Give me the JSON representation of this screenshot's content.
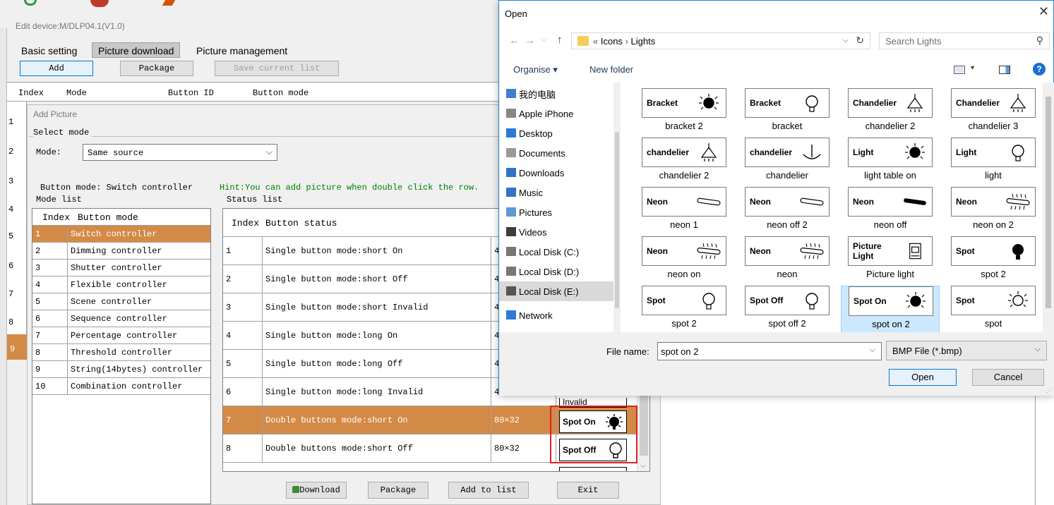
{
  "main": {
    "title": "Edit device:M/DLP04.1(V1.0)",
    "tabs": [
      "Basic setting",
      "Picture download",
      "Picture management"
    ],
    "toolbar": {
      "add": "Add",
      "package": "Package",
      "save": "Save current list"
    },
    "columns": {
      "index": "Index",
      "mode": "Mode",
      "button_id": "Button ID",
      "button_mode": "Button mode"
    },
    "row_numbers": [
      "1",
      "2",
      "3",
      "4",
      "5",
      "6",
      "7",
      "8",
      "9"
    ]
  },
  "add_picture": {
    "title": "Add Picture",
    "select_mode_label": "Select mode",
    "mode_label": "Mode:",
    "mode_value": "Same source",
    "button_mode_text": "Button mode:  Switch controller",
    "hint": "Hint:You can add picture when double click the row.",
    "mode_list_label": "Mode list",
    "mode_list_header": {
      "index": "Index",
      "mode": "Button mode"
    },
    "mode_list": [
      {
        "index": "1",
        "name": "Switch controller"
      },
      {
        "index": "2",
        "name": "Dimming controller"
      },
      {
        "index": "3",
        "name": "Shutter controller"
      },
      {
        "index": "4",
        "name": "Flexible controller"
      },
      {
        "index": "5",
        "name": "Scene controller"
      },
      {
        "index": "6",
        "name": "Sequence controller"
      },
      {
        "index": "7",
        "name": "Percentage controller"
      },
      {
        "index": "8",
        "name": "Threshold controller"
      },
      {
        "index": "9",
        "name": "String(14bytes) controller"
      },
      {
        "index": "10",
        "name": "Combination controller"
      }
    ],
    "status_list_label": "Status list",
    "status_header": {
      "index": "Index",
      "status": "Button status"
    },
    "status_rows": [
      {
        "index": "1",
        "status": "Single button mode:short On",
        "size": "4"
      },
      {
        "index": "2",
        "status": "Single button mode:short Off",
        "size": "4"
      },
      {
        "index": "3",
        "status": "Single button mode:short Invalid",
        "size": "4"
      },
      {
        "index": "4",
        "status": "Single button mode:long On",
        "size": "4"
      },
      {
        "index": "5",
        "status": "Single button mode:long Off",
        "size": "4"
      },
      {
        "index": "6",
        "status": "Single button mode:long Invalid",
        "size": "4"
      },
      {
        "index": "7",
        "status": "Double buttons mode:short On",
        "size": "80×32"
      },
      {
        "index": "8",
        "status": "Double buttons mode:short Off",
        "size": "80×32"
      }
    ],
    "partial_preview_text": "Invalid",
    "preview_on": "Spot On",
    "preview_off": "Spot Off",
    "buttons": {
      "download": "Download",
      "package": "Package",
      "add_to_list": "Add to list",
      "exit": "Exit"
    }
  },
  "open_dialog": {
    "title": "Open",
    "breadcrumb": {
      "prefix": "«",
      "part1": "Icons",
      "sep": "›",
      "part2": "Lights"
    },
    "search_placeholder": "Search Lights",
    "organise": "Organise ▾",
    "new_folder": "New folder",
    "nav_items": [
      "我的电脑",
      "Apple iPhone",
      "Desktop",
      "Documents",
      "Downloads",
      "Music",
      "Pictures",
      "Videos",
      "Local Disk (C:)",
      "Local Disk (D:)",
      "Local Disk (E:)",
      "Network"
    ],
    "files": [
      {
        "label": "bracket 2",
        "tile_text": "Bracket"
      },
      {
        "label": "bracket",
        "tile_text": "Bracket"
      },
      {
        "label": "chandelier 2",
        "tile_text": "Chandelier"
      },
      {
        "label": "chandelier 3",
        "tile_text": "Chandelier"
      },
      {
        "label": "chandelier 2",
        "tile_text": "chandelier"
      },
      {
        "label": "chandelier",
        "tile_text": "chandelier"
      },
      {
        "label": "light table on",
        "tile_text": "Light"
      },
      {
        "label": "light",
        "tile_text": "Light"
      },
      {
        "label": "neon 1",
        "tile_text": "Neon"
      },
      {
        "label": "neon off 2",
        "tile_text": "Neon"
      },
      {
        "label": "neon off",
        "tile_text": "Neon"
      },
      {
        "label": "neon on 2",
        "tile_text": "Neon"
      },
      {
        "label": "neon on",
        "tile_text": "Neon"
      },
      {
        "label": "neon",
        "tile_text": "Neon"
      },
      {
        "label": "Picture light",
        "tile_text": "Picture Light"
      },
      {
        "label": "spot  2",
        "tile_text": "Spot"
      },
      {
        "label": "spot 2",
        "tile_text": "Spot"
      },
      {
        "label": "spot off 2",
        "tile_text": "Spot Off"
      },
      {
        "label": "spot on 2",
        "tile_text": "Spot On"
      },
      {
        "label": "spot",
        "tile_text": "Spot"
      }
    ],
    "file_name_label": "File name:",
    "file_name_value": "spot on 2",
    "file_type": "BMP File (*.bmp)",
    "open_button": "Open",
    "cancel_button": "Cancel"
  },
  "colors": {
    "selected_row": "#d48a47",
    "accent_blue": "#0078d7",
    "highlight_box": "#e02020",
    "hint_green": "#008000"
  }
}
